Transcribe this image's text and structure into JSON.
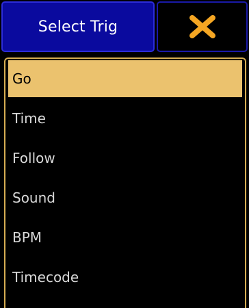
{
  "header": {
    "title": "Select Trig",
    "close_icon": "close-x-icon",
    "colors": {
      "title_bg": "#0a0a9e",
      "close_icon": "#f5a623"
    }
  },
  "list": {
    "selected_index": 0,
    "items": [
      {
        "label": "Go"
      },
      {
        "label": "Time"
      },
      {
        "label": "Follow"
      },
      {
        "label": "Sound"
      },
      {
        "label": "BPM"
      },
      {
        "label": "Timecode"
      }
    ],
    "colors": {
      "frame": "#d6ad52",
      "selected_bg": "#ebc26e"
    }
  }
}
